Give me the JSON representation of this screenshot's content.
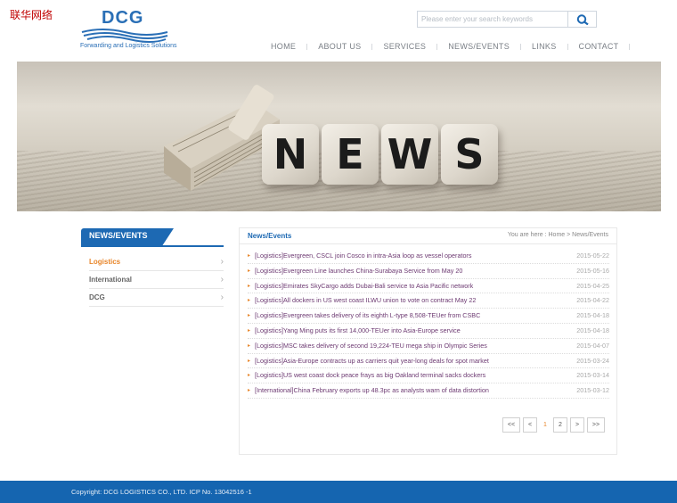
{
  "site_tag": "联华网络",
  "logo": {
    "text": "DCG",
    "tagline": "Forwarding and Logistics Solutions"
  },
  "search": {
    "placeholder": "Please enter your search keywords"
  },
  "nav": [
    "HOME",
    "ABOUT US",
    "SERVICES",
    "NEWS/EVENTS",
    "LINKS",
    "CONTACT"
  ],
  "banner": {
    "word": [
      "N",
      "E",
      "W",
      "S"
    ]
  },
  "sidebar": {
    "heading": "NEWS/EVENTS",
    "items": [
      {
        "label": "Logistics",
        "active": true
      },
      {
        "label": "International",
        "active": false
      },
      {
        "label": "DCG",
        "active": false
      }
    ]
  },
  "content": {
    "title": "News/Events",
    "breadcrumb": "You are here : Home > News/Events",
    "news": [
      {
        "title": "[Logistics]Evergreen, CSCL join Cosco in intra-Asia loop as vessel operators",
        "date": "2015-05-22"
      },
      {
        "title": "[Logistics]Evergreen Line launches China-Surabaya Service from May 20",
        "date": "2015-05-16"
      },
      {
        "title": "[Logistics]Emirates SkyCargo adds Dubai-Bali service to Asia Pacific network",
        "date": "2015-04-25"
      },
      {
        "title": "[Logistics]All dockers in US west coast ILWU union to vote on contract May 22",
        "date": "2015-04-22"
      },
      {
        "title": "[Logistics]Evergreen takes delivery of its eighth L-type 8,508-TEUer from CSBC",
        "date": "2015-04-18"
      },
      {
        "title": "[Logistics]Yang Ming puts its first 14,000-TEUer into Asia-Europe service",
        "date": "2015-04-18"
      },
      {
        "title": "[Logistics]MSC takes delivery of second 19,224-TEU mega ship in Olympic Series",
        "date": "2015-04-07"
      },
      {
        "title": "[Logistics]Asia-Europe contracts up as carriers quit year-long deals for spot market",
        "date": "2015-03-24"
      },
      {
        "title": "[Logistics]US west coast dock peace frays as big Oakland terminal sacks dockers",
        "date": "2015-03-14"
      },
      {
        "title": "[International]China February exports up 48.3pc as analysts warn of data distortion",
        "date": "2015-03-12"
      }
    ],
    "pager": {
      "first": "<<",
      "prev": "<",
      "pages": [
        "1",
        "2"
      ],
      "current": "1",
      "next": ">",
      "last": ">>"
    }
  },
  "footer": {
    "text": "Copyright: DCG LOGISTICS CO., LTD. ICP No. 13042516 -1"
  },
  "colors": {
    "brand_blue": "#1d69b3",
    "accent_orange": "#e8862a",
    "news_title": "#6d3a72",
    "footer": "#1565b0"
  }
}
